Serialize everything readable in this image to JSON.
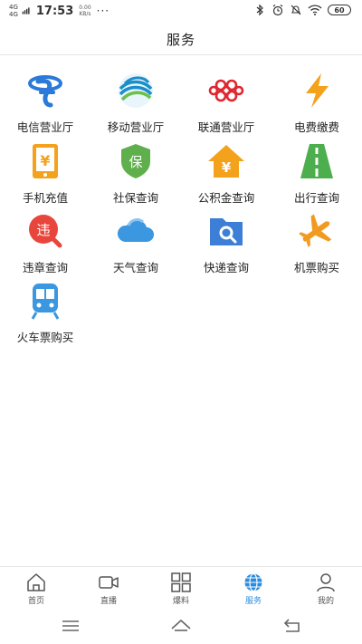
{
  "status_bar": {
    "network": "4G",
    "time": "17:53",
    "speed": "0.00",
    "speed_unit": "KB/s",
    "more": "···",
    "battery": "60"
  },
  "header": {
    "title": "服务"
  },
  "services": [
    {
      "label": "电信营业厅",
      "icon": "telecom-logo-icon",
      "color": "#2b79d8"
    },
    {
      "label": "移动营业厅",
      "icon": "mobile-logo-icon",
      "color": "#1a8ec9"
    },
    {
      "label": "联通营业厅",
      "icon": "unicom-logo-icon",
      "color": "#e0262f"
    },
    {
      "label": "电费缴费",
      "icon": "lightning-icon",
      "color": "#f4a21c"
    },
    {
      "label": "手机充值",
      "icon": "phone-recharge-icon",
      "color": "#f4a21c"
    },
    {
      "label": "社保查询",
      "icon": "social-security-shield-icon",
      "color": "#5fb04c"
    },
    {
      "label": "公积金查询",
      "icon": "house-fund-icon",
      "color": "#f4a21c"
    },
    {
      "label": "出行查询",
      "icon": "road-icon",
      "color": "#4cae4c"
    },
    {
      "label": "违章查询",
      "icon": "violation-icon",
      "color": "#e8463c"
    },
    {
      "label": "天气查询",
      "icon": "cloud-icon",
      "color": "#3a97e0"
    },
    {
      "label": "快递查询",
      "icon": "express-folder-search-icon",
      "color": "#3d7fd6"
    },
    {
      "label": "机票购买",
      "icon": "airplane-icon",
      "color": "#f29a1f"
    },
    {
      "label": "火车票购买",
      "icon": "train-icon",
      "color": "#3a97e0"
    }
  ],
  "bottom_nav": [
    {
      "label": "首页",
      "icon": "home-icon",
      "active": false
    },
    {
      "label": "直播",
      "icon": "video-camera-icon",
      "active": false
    },
    {
      "label": "爆料",
      "icon": "grid-icon",
      "active": false
    },
    {
      "label": "服务",
      "icon": "globe-icon",
      "active": true
    },
    {
      "label": "我的",
      "icon": "user-icon",
      "active": false
    }
  ],
  "colors": {
    "accent": "#2a8be0",
    "divider": "#e4e4e4"
  }
}
